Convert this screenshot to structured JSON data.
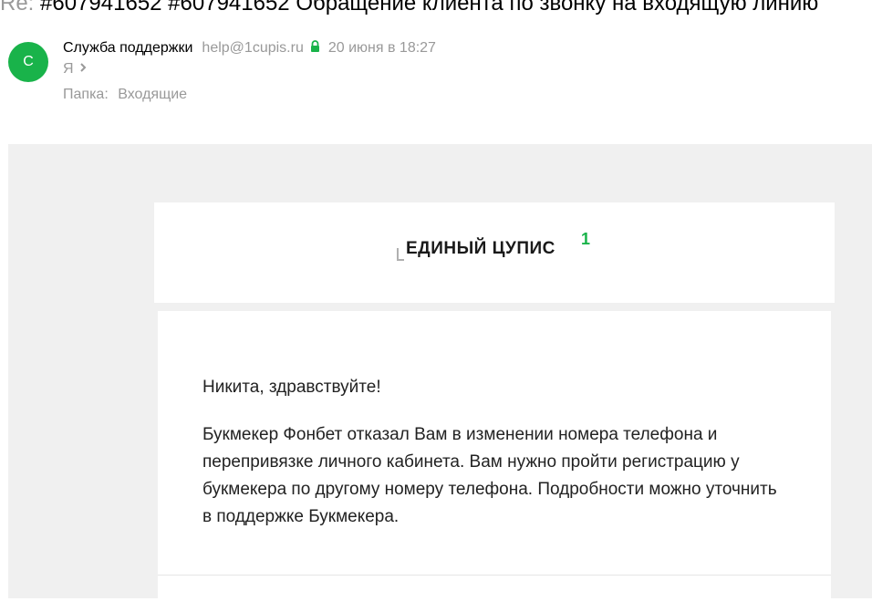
{
  "email": {
    "subject_prefix": "Re:",
    "subject": "#607941652 #607941652 Обращение клиента по звонку на входящую линию",
    "avatar_letter": "С",
    "sender_name": "Служба поддержки",
    "sender_email": "help@1cupis.ru",
    "date": "20 июня в 18:27",
    "recipient": "Я",
    "folder_label": "Папка:",
    "folder_name": "Входящие"
  },
  "body": {
    "logo_text": "ЕДИНЫЙ ЦУПИС",
    "logo_superscript": "1",
    "greeting": "Никита, здравствуйте!",
    "message": "Букмекер Фонбет отказал Вам в изменении номера телефона и перепривязке личного кабинета. Вам нужно пройти регистрацию у букмекера по другому номеру телефона. Подробности можно уточнить в поддержке Букмекера."
  },
  "colors": {
    "avatar_bg": "#19b34a",
    "lock": "#19b34a",
    "muted_text": "#999999",
    "mail_background": "#f0f0f0"
  },
  "icons": {
    "secure": "lock-icon",
    "expand": "chevron-right-icon"
  }
}
